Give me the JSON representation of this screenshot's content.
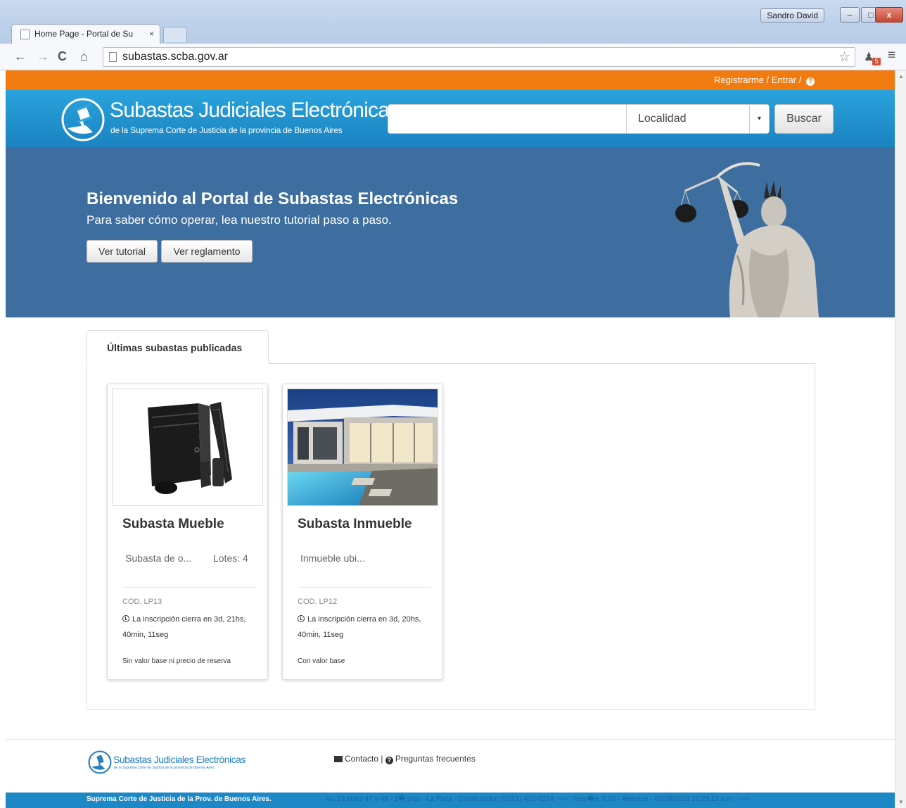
{
  "browser": {
    "tab_title": "Home Page - Portal de Su",
    "tab_close": "×",
    "url": "subastas.scba.gov.ar",
    "user": "Sandro David",
    "ext_badge": "5",
    "controls": {
      "minimize": "–",
      "maximize": "□",
      "close": "x"
    },
    "icons": {
      "back": "←",
      "forward": "→",
      "reload": "C",
      "home": "⌂",
      "star": "☆",
      "bell": "♟",
      "menu": "≡"
    }
  },
  "topbar": {
    "auth": "Registrarme / Entrar /",
    "help_glyph": "?"
  },
  "header": {
    "title": "Subastas Judiciales Electrónicas",
    "subtitle": "de la Suprema Corte de Justicia de la provincia de Buenos Aires",
    "search_placeholder": "",
    "locality": "Localidad",
    "caret": "▾",
    "search_button": "Buscar"
  },
  "hero": {
    "title": "Bienvenido al Portal de Subastas Electrónicas",
    "subtitle": "Para saber cómo operar, lea nuestro tutorial paso a paso.",
    "tutorial_button": "Ver tutorial",
    "rules_button": "Ver reglamento"
  },
  "listing": {
    "tab_label": "Últimas subastas publicadas",
    "cards": [
      {
        "title": "Subasta Mueble",
        "desc": "Subasta de o...",
        "lots": "Lotes: 4",
        "code": "COD. LP13",
        "deadline": "La inscripción cierra en 3d, 21hs, 40min, 11seg",
        "base": "Sin valor base ni precio de reserva"
      },
      {
        "title": "Subasta Inmueble",
        "desc": "Inmueble ubi...",
        "lots": "",
        "code": "COD. LP12",
        "deadline": "La inscripción cierra en 3d, 20hs, 40min, 11seg",
        "base": "Con valor base"
      }
    ]
  },
  "footer": {
    "title": "Subastas Judiciales Electrónicas",
    "subtitle": "de la Suprema Corte de Justicia de la provincia de Buenos Aires",
    "contact": "Contacto",
    "separator": "|",
    "faq": "Preguntas frecuentes",
    "faq_glyph": "?",
    "org": "Suprema Corte de Justicia de la Prov. de Buenos Aires.",
    "info": "Av. 13 entre 47 y 48 - 1� piso - La Plata - Conmutador: (0221)-410-0214. <<< Versi�n: 0.56 - Release - 03/06/2015 10:23:12 a.m. >>>"
  },
  "colors": {
    "orange": "#f07b10",
    "header_blue": "#1a83c1",
    "hero_blue": "#3d6e9f",
    "footer_blue": "#1e88c7"
  }
}
